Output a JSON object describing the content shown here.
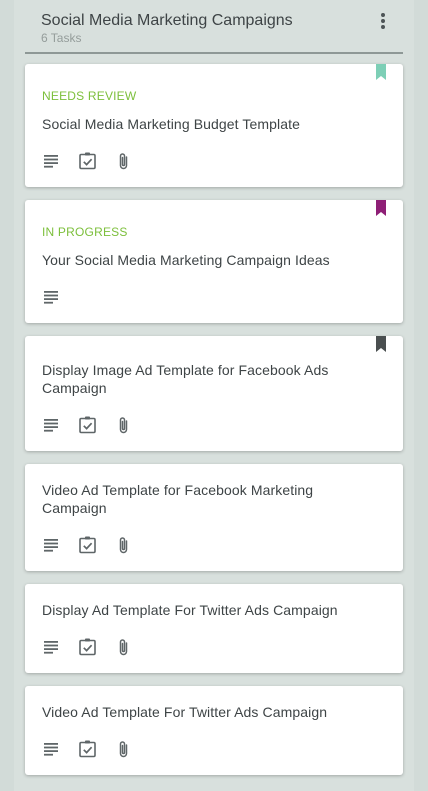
{
  "column": {
    "title": "Social Media Marketing Campaigns",
    "task_count": "6 Tasks"
  },
  "cards": [
    {
      "status": "NEEDS REVIEW",
      "title": "Social Media Marketing Budget Template",
      "bookmark_color": "#7dcfb6",
      "icons": [
        "description-icon",
        "checklist-icon",
        "attachment-icon"
      ]
    },
    {
      "status": "IN PROGRESS",
      "title": "Your Social Media Marketing Campaign Ideas",
      "bookmark_color": "#8e1f76",
      "icons": [
        "description-icon"
      ]
    },
    {
      "status": "",
      "title": "Display Image Ad Template for Facebook Ads Campaign",
      "bookmark_color": "#4a4f50",
      "icons": [
        "description-icon",
        "checklist-icon",
        "attachment-icon"
      ]
    },
    {
      "status": "",
      "title": "Video Ad Template for Facebook Marketing Campaign",
      "bookmark_color": "",
      "icons": [
        "description-icon",
        "checklist-icon",
        "attachment-icon"
      ]
    },
    {
      "status": "",
      "title": "Display Ad Template For Twitter Ads Campaign",
      "bookmark_color": "",
      "icons": [
        "description-icon",
        "checklist-icon",
        "attachment-icon"
      ]
    },
    {
      "status": "",
      "title": "Video Ad Template For Twitter Ads Campaign",
      "bookmark_color": "",
      "icons": [
        "description-icon",
        "checklist-icon",
        "attachment-icon"
      ]
    }
  ],
  "colors": {
    "status_text": "#7cbf3b",
    "icon": "#5f6668",
    "background": "#d8e0dd"
  }
}
